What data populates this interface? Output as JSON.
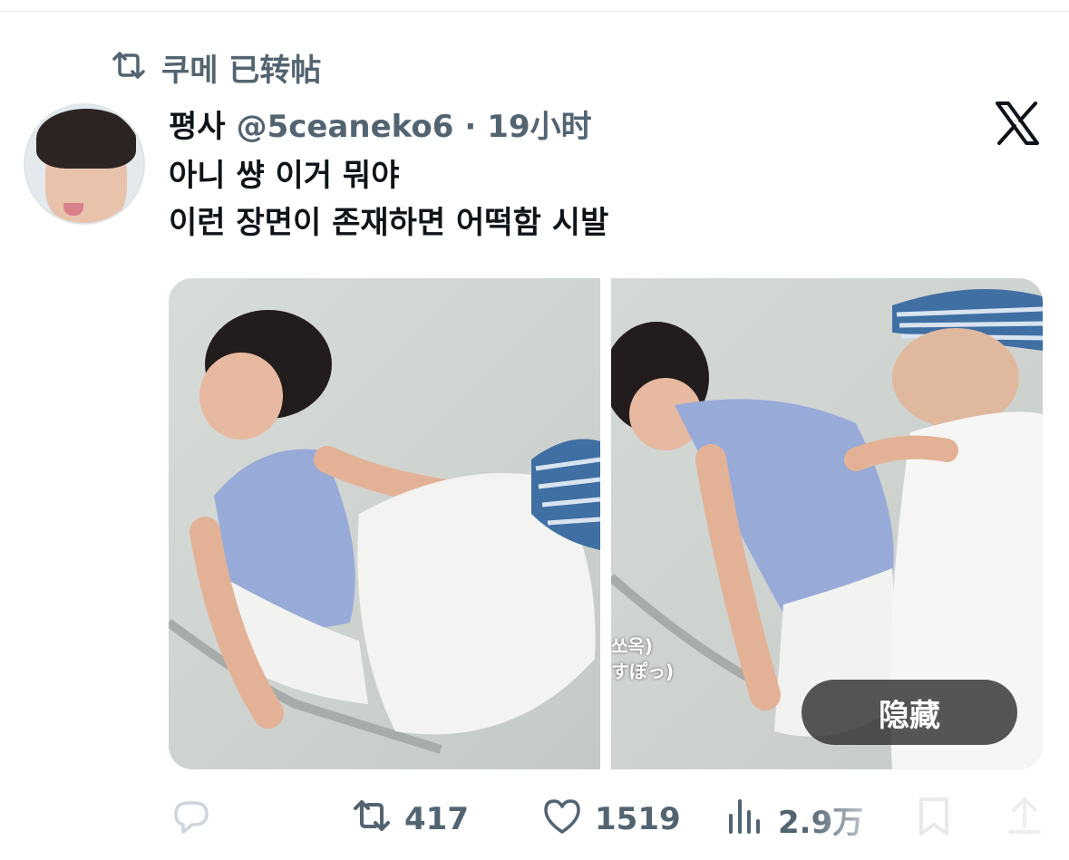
{
  "repost": {
    "icon": "repost-icon",
    "text": "쿠메 已转帖"
  },
  "author": {
    "name": "평사",
    "handle": "@5ceaneko6",
    "separator": "·",
    "time": "19小时"
  },
  "brand_icon": "x-logo-icon",
  "tweet": {
    "lines": [
      "아니 썅 이거 뭐야",
      "이런 장면이 존재하면 어떡함 시발"
    ]
  },
  "media": {
    "photos": [
      "photo-1",
      "photo-2"
    ],
    "subtitle_lines": [
      "쏘옥)",
      "すぽっ)"
    ],
    "hide_label": "隐藏"
  },
  "actions": {
    "reply": {
      "icon": "reply-icon",
      "count": ""
    },
    "retweet": {
      "icon": "retweet-icon",
      "count": "417"
    },
    "like": {
      "icon": "heart-icon",
      "count": "1519"
    },
    "views": {
      "icon": "views-icon",
      "count": "2.9万"
    },
    "bookmark": {
      "icon": "bookmark-icon",
      "count": ""
    },
    "share": {
      "icon": "share-icon",
      "count": ""
    }
  },
  "colors": {
    "text_primary": "#0f1419",
    "text_secondary": "#536471",
    "hide_button_bg": "#282828"
  }
}
